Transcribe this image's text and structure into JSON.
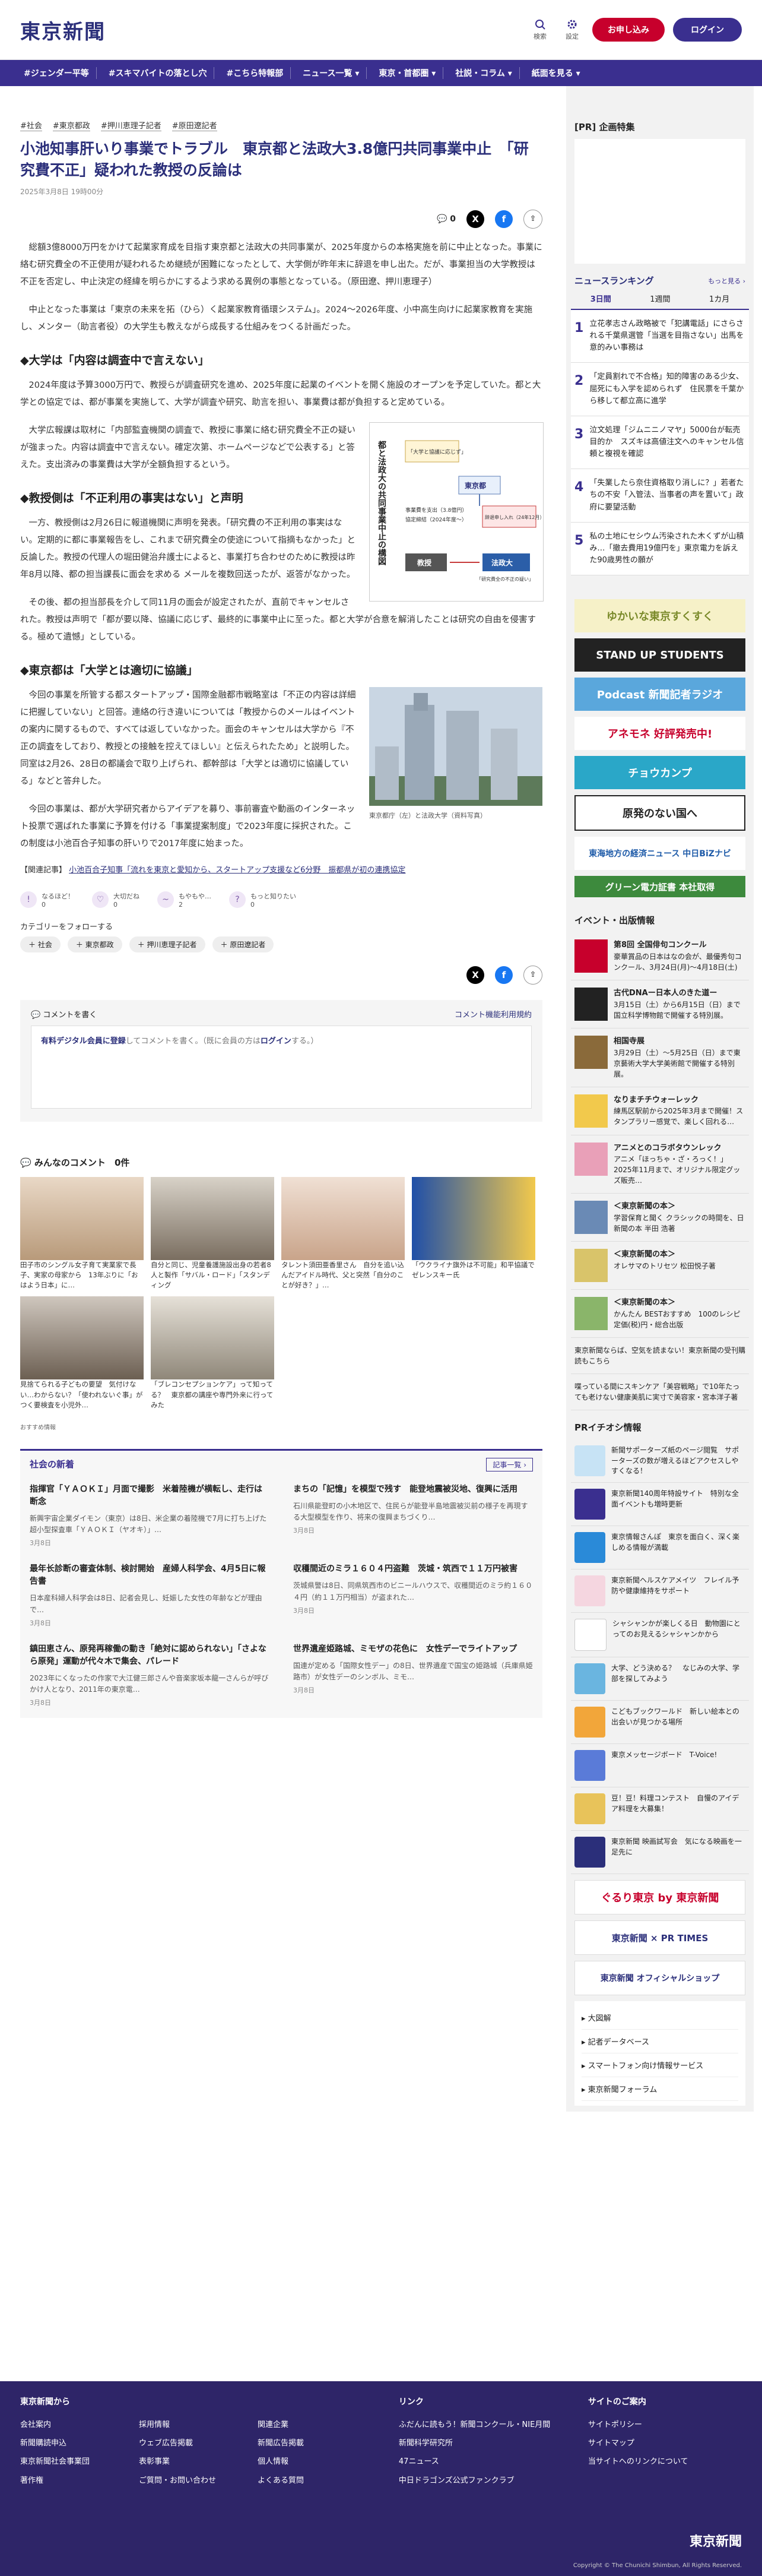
{
  "header": {
    "logo": "東京新聞",
    "search": "検索",
    "settings": "設定",
    "signup": "お申し込み",
    "login": "ログイン"
  },
  "nav": [
    "#ジェンダー平等",
    "#スキマバイトの落とし穴",
    "#こちら特報部",
    "ニュース一覧 ▾",
    "東京・首都圏 ▾",
    "社説・コラム ▾",
    "紙面を見る ▾"
  ],
  "article": {
    "tags": [
      "#社会",
      "#東京都政",
      "#押川恵理子記者",
      "#原田遼記者"
    ],
    "title": "小池知事肝いり事業でトラブル　東京都と法政大3.8億円共同事業中止　「研究費不正」疑われた教授の反論は",
    "date": "2025年3月8日 19時00分",
    "comment_count": "0",
    "paragraphs": [
      "総額3億8000万円をかけて起業家育成を目指す東京都と法政大の共同事業が、2025年度からの本格実施を前に中止となった。事業に絡む研究費全の不正使用が疑われるため継続が困難になったとして、大学側が昨年末に辞退を申し出た。だが、事業担当の大学教授は不正を否定し、中止決定の経緯を明らかにするよう求める異例の事態となっている。（原田遼、押川恵理子）",
      "中止となった事業は「東京の未来を拓（ひら）く起業家教育循環システム」。2024〜2026年度、小中高生向けに起業家教育を実施し、メンター（助言者役）の大学生も教えながら成長する仕組みをつくる計画だった。"
    ],
    "h2_1": "◆大学は「内容は調査中で言えない」",
    "paragraphs2": [
      "2024年度は予算3000万円で、教授らが調査研究を進め、2025年度に起業のイベントを開く施設のオープンを予定していた。都と大学との協定では、都が事業を実施して、大学が調査や研究、助言を担い、事業費は都が負担すると定めている。",
      "大学広報課は取材に「内部監査機関の調査で、教授に事業に絡む研究費全不正の疑いが強まった。内容は調査中で言えない。確定次第、ホームページなどで公表する」と答えた。支出済みの事業費は大学が全額負担するという。"
    ],
    "h2_2": "◆教授側は「不正利用の事実はない」と声明",
    "paragraphs3": [
      "一方、教授側は2月26日に報道機関に声明を発表。「研究費の不正利用の事実はない。定期的に都に事業報告をし、これまで研究費全の使途について指摘もなかった」と反論した。教授の代理人の堀田健治弁護士によると、事業打ち合わせのために教授は昨年8月以降、都の担当課長に面会を求める メールを複数回送ったが、返答がなかった。",
      "その後、都の担当部長を介して同11月の面会が設定されたが、直前でキャンセルされた。教授は声明で「都が要以降、協議に応じず、最終的に事業中止に至った。都と大学が合意を解消したことは研究の自由を侵害する。極めて遺憾」としている。"
    ],
    "h2_3": "◆東京都は「大学とは適切に協議」",
    "paragraphs4": [
      "今回の事業を所管する都スタートアップ・国際金融都市戦略室は「不正の内容は詳細に把握していない」と回答。連絡の行き違いについては「教授からのメールはイベント の案内に関するもので、すべては返していなかった。面会のキャンセルは大学から『不正の調査をしており、教授との接触を控えてほしい』と伝えられたため」と説明した。同室は2月26、28日の都議会で取り上げられ、都幹部は「大学とは適切に協議している」などと答弁した。",
      "今回の事業は、都が大学研究者からアイデアを募り、事前審査や動画のインターネット投票で選ばれた事業に予算を付ける「事業提案制度」で2023年度に採択された。この制度は小池百合子知事の肝いりで2017年度に始まった。"
    ],
    "figure1_caption": "",
    "figure2_caption": "東京都庁（左）と法政大学（資料写真）",
    "related_label": "【関連記事】",
    "related_link": "小池百合子知事「流れを東京と愛知から、スタートアップ支援など6分野　振都県が初の連携協定",
    "diagram": {
      "title": "都と法政大の共同事業中止の構図",
      "box1": "「大学と協議に応じず」",
      "box2": "東京都",
      "box3": "事業費を支出（3.8億円）",
      "box4": "協定締結（2024年度〜）",
      "box5": "辞退申し入れ（24年12月）",
      "box6": "教授",
      "box7": "法政大",
      "box8": "「研究費全の不正の疑い」"
    }
  },
  "reactions": [
    {
      "label": "なるほど！",
      "count": "0"
    },
    {
      "label": "大切だね",
      "count": "0"
    },
    {
      "label": "もやもや…",
      "count": "2"
    },
    {
      "label": "もっと知りたい",
      "count": "0"
    }
  ],
  "follow": {
    "label": "カテゴリーをフォローする",
    "chips": [
      "社会",
      "東京都政",
      "押川恵理子記者",
      "原田遼記者"
    ]
  },
  "comment": {
    "title": "コメントを書く",
    "feature_link": "コメント機能利用規約",
    "prompt_a": "有料デジタル会員に登録",
    "prompt_b": "してコメントを書く。（既に会員の方は",
    "prompt_c": "ログイン",
    "prompt_d": "する。）"
  },
  "everyone": {
    "title": "みんなのコメント",
    "count": "0件"
  },
  "cards": [
    {
      "text": "田子市のシングル女子育て実業家で長子、実家の母家から　13年ぶりに「おはよう日本」に…"
    },
    {
      "text": "自分と同じ、児童養護施設出身の若者8人と製作「サバル・ロード」「スタンディング"
    },
    {
      "text": "タレント須田亜香里さん　自分を追い込んだアイドル時代、父と突然「自分のことが好き？」…"
    },
    {
      "text": "「ウクライナ旗外は不可能」和平協議でゼレンスキー氏"
    },
    {
      "text": "見捨てられる子どもの要望　気付けない…わからない？「使われないぐ事」がつく要検査を小児外…"
    },
    {
      "text": "「ブレコンセプションケア」って知ってる？　東京都の講座や専門外来に行ってみた"
    }
  ],
  "osusume": "おすすめ情報",
  "news": {
    "title": "社会の新着",
    "more": "記事一覧 ›",
    "items": [
      {
        "t": "指揮官「ＹＡＯＫＩ」月面で撮影　米着陸機が横転し、走行は断念",
        "d": "新興宇宙企業ダイモン（東京）は8日、米企業の着陸機で7月に打ち上げた超小型探査車「ＹＡＯＫＩ（ヤオキ）」…",
        "dt": "3月8日"
      },
      {
        "t": "まちの「記憶」を模型で残す　能登地震被災地、復興に活用",
        "d": "石川県能登町の小木地区で、住民らが能登半島地震被災前の様子を再現する大型模型を作り、将来の復興まちづくり…",
        "dt": "3月8日"
      },
      {
        "t": "最年长診断の審査体制、検討開始　産婦人科学会、4月5日に報告書",
        "d": "日本産科婦人科学会は8日、記者会見し、妊娠した女性の年齢などが理由で…",
        "dt": "3月8日"
      },
      {
        "t": "収穫間近のミラ１６０４円盗難　茨城・筑西で１１万円被害",
        "d": "茨城県警は8日、同県筑西市のビニールハウスで、収穫間近のミラ約１６０４円（約１１万円相当）が盗まれた…",
        "dt": "3月8日"
      },
      {
        "t": "鎮田恵さん、原発再稼働の動き「絶対に認められない」「さよなら原発」運動が代々木で集会、パレード",
        "d": "2023年にくなったの作家で大江健三郎さんや音楽家坂本龍一さんらが呼びかけ人となり、2011年の東京電…",
        "dt": "3月8日"
      },
      {
        "t": "世界遺産姫路城、ミモザの花色に　女性デーでライトアップ",
        "d": "国連が定める「国際女性デー」の8日、世界遺産で国宝の姫路城（兵庫県姫路市）が女性デーのシンボル、ミモ…",
        "dt": "3月8日"
      }
    ]
  },
  "side": {
    "pr_title": "[PR] 企画特集",
    "ranking_title": "ニュースランキング",
    "ranking_more": "もっと見る ›",
    "ranking_tabs": [
      "3日間",
      "1週間",
      "1カ月"
    ],
    "ranking": [
      "立花孝志さん政略被で「犯講電話」にさらされる千葉県選管「当選を目指さない」出馬を意的みい事務は",
      "「定員割れで不合格」知的障害のある少女、屈死にも入学を認められず　住民票を千葉から移して都立高に進学",
      "泣文処理「ジムニニノマヤ」5000台が転売目的か　スズキは高値注文へのキャンセル信頼と複視を確認",
      "「失業したら奈住資格取り消しに？」若者たちの不安「入管法、当事者の声を置いて」政府に要望活動",
      "私の土地にセシウム汚染された木くずが山積み…「撤去費用19億円を」東京電力を訴えた90歳男性の願が"
    ],
    "banners": [
      "ゆかいな東京すくすく",
      "STAND UP STUDENTS",
      "Podcast 新聞記者ラジオ",
      "アネモネ 好評発売中!",
      "チョウカンプ",
      "原発のない国へ",
      "東海地方の経済ニュース 中日BiZナビ",
      "グリーン電力証書 本社取得"
    ],
    "events_title": "イベント・出版情報",
    "events": [
      {
        "t": "第8回 全国俳句コンクール",
        "d": "豪華賞品の日本はなの会が、最優秀句コンクール、3月24日(月)〜4月18日(土)"
      },
      {
        "t": "古代DNAー日本人のきた道ー",
        "d": "3月15日（土）から6月15日（日）まで国立科学博物館で開催する特別展。"
      },
      {
        "t": "相国寺展",
        "d": "3月29日（土）〜5月25日（日）まで東京藝術大学大学美術館で開催する特別展。"
      },
      {
        "t": "なりまチチウォーレック",
        "d": "練馬区駅前から2025年3月まで開催！スタンプラリー感覚で、楽しく回れる…"
      },
      {
        "t": "アニメとのコラボタウンレック",
        "d": "アニメ「ほっちゃ・ざ・ろっく！」2025年11月まで、オリジナル限定グッズ販売…"
      },
      {
        "t": "＜東京新聞の本＞",
        "d": "学習保育と聞く クラシックの時間を、日新聞の本 半田 浩著"
      },
      {
        "t": "＜東京新聞の本＞",
        "d": "オレサマのトリセツ 松田悦子著"
      },
      {
        "t": "＜東京新聞の本＞",
        "d": "かんたん BESTおすすめ　100のレシピ 定価(税)円・総合出版"
      }
    ],
    "promo1": "東京新聞ならば、空気を読まない！東京新聞の受刊購読もこちら",
    "promo2": "喋っている間にスキンケア「美容戦略」で10年たっても老けない健康美肌に実寸で美容家・宮本洋子著",
    "pr_info_title": "PRイチオシ情報",
    "pr_items": [
      "新聞サポーターズ紙のページ閲覧　サポーターズの数が増えるほどアクセスしやすくなる！",
      "東京新聞140周年特設サイト　特別な全面イベントも増時更新",
      "東京情報さんぽ　東京を面白く、深く楽しめる情報が満載",
      "東京新聞ヘルスケアメイツ　フレイル予防や健康維持をサポート",
      "シャシャンかが楽しくる日　動物園にとってのお見えるシャシャンかから",
      "大学、どう決める？　なじみの大学、学部を探してみよう",
      "こどもブックワールド　新しい絵本との出会いが見つかる場所",
      "東京メッセージボード　T-Voice!",
      "豆！豆！料理コンテスト　自慢のアイデア料理を大募集！",
      "東京新聞 映画試写会　気になる映画を一足先に"
    ],
    "pr_banners": [
      "ぐるり東京 by 東京新聞",
      "東京新聞 × PR TIMES",
      "東京新聞 オフィシャルショップ"
    ],
    "links": [
      "大図解",
      "記者データベース",
      "スマートフォン向け情報サービス",
      "東京新聞フォーラム"
    ]
  },
  "footer": {
    "col1_title": "東京新聞から",
    "col1": [
      "会社案内",
      "採用情報",
      "関連企業",
      "新聞購読申込",
      "ウェブ広告掲載",
      "新聞広告掲載",
      "東京新聞社会事業団",
      "表彰事業",
      "個人情報",
      "著作権",
      "ご質問・お問い合わせ",
      "よくある質問"
    ],
    "col2_title": "リンク",
    "col2": [
      "ふだんに読もう！新聞コンクール・NIE月間",
      "新聞科学研究所",
      "47ニュース",
      "中日ドラゴンズ公式ファンクラブ"
    ],
    "col3_title": "サイトのご案内",
    "col3": [
      "サイトポリシー",
      "サイトマップ",
      "当サイトへのリンクについて"
    ],
    "logo": "東京新聞",
    "copyright": "Copyright © The Chunichi Shimbun, All Rights Reserved."
  }
}
